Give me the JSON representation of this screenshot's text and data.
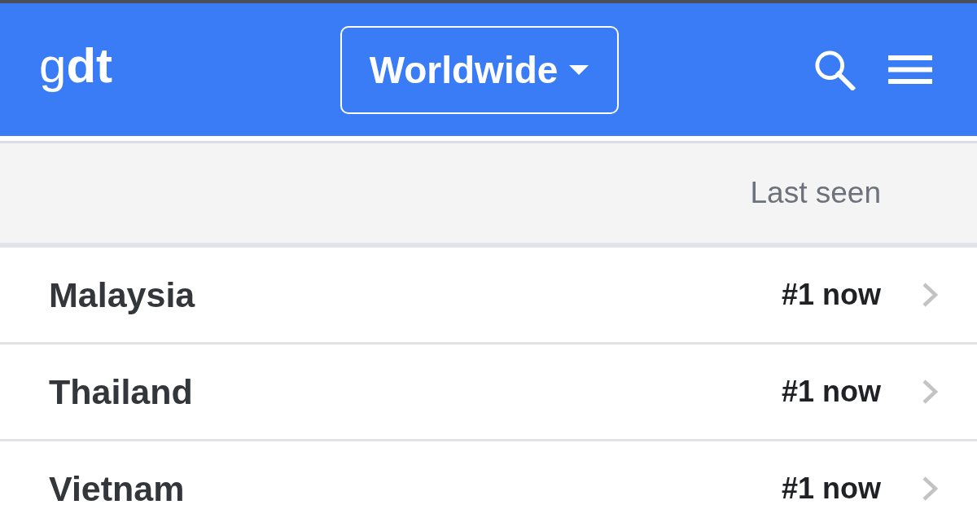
{
  "header": {
    "logo": "g**dt**",
    "region_button": {
      "label": "Worldwide"
    }
  },
  "table": {
    "columns": [
      {
        "label": "Last seen"
      }
    ],
    "rows": [
      {
        "name": "Malaysia",
        "last_seen": "#1 now"
      },
      {
        "name": "Thailand",
        "last_seen": "#1 now"
      },
      {
        "name": "Vietnam",
        "last_seen": "#1 now"
      }
    ]
  }
}
